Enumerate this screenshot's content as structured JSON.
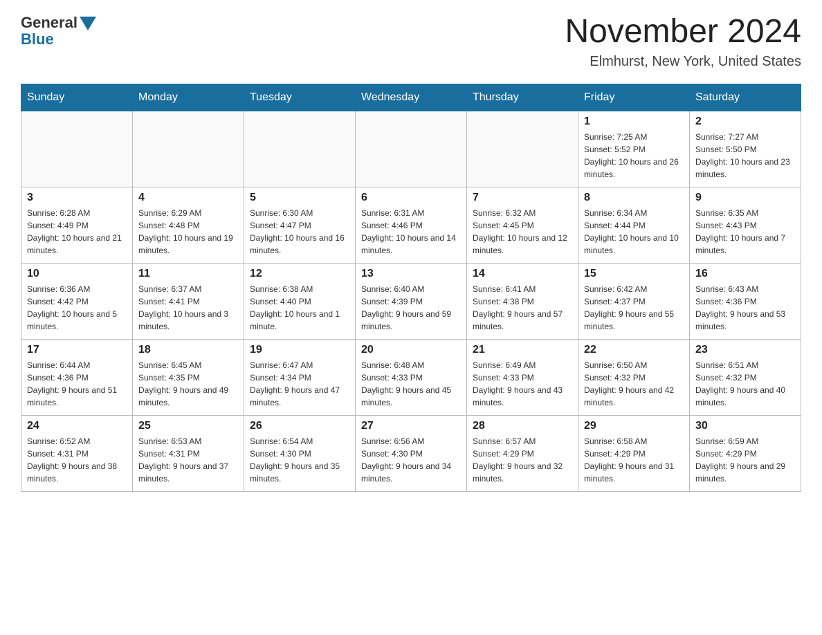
{
  "header": {
    "logo_general": "General",
    "logo_blue": "Blue",
    "month_title": "November 2024",
    "location": "Elmhurst, New York, United States"
  },
  "days_of_week": [
    "Sunday",
    "Monday",
    "Tuesday",
    "Wednesday",
    "Thursday",
    "Friday",
    "Saturday"
  ],
  "weeks": [
    [
      {
        "day": "",
        "sunrise": "",
        "sunset": "",
        "daylight": ""
      },
      {
        "day": "",
        "sunrise": "",
        "sunset": "",
        "daylight": ""
      },
      {
        "day": "",
        "sunrise": "",
        "sunset": "",
        "daylight": ""
      },
      {
        "day": "",
        "sunrise": "",
        "sunset": "",
        "daylight": ""
      },
      {
        "day": "",
        "sunrise": "",
        "sunset": "",
        "daylight": ""
      },
      {
        "day": "1",
        "sunrise": "Sunrise: 7:25 AM",
        "sunset": "Sunset: 5:52 PM",
        "daylight": "Daylight: 10 hours and 26 minutes."
      },
      {
        "day": "2",
        "sunrise": "Sunrise: 7:27 AM",
        "sunset": "Sunset: 5:50 PM",
        "daylight": "Daylight: 10 hours and 23 minutes."
      }
    ],
    [
      {
        "day": "3",
        "sunrise": "Sunrise: 6:28 AM",
        "sunset": "Sunset: 4:49 PM",
        "daylight": "Daylight: 10 hours and 21 minutes."
      },
      {
        "day": "4",
        "sunrise": "Sunrise: 6:29 AM",
        "sunset": "Sunset: 4:48 PM",
        "daylight": "Daylight: 10 hours and 19 minutes."
      },
      {
        "day": "5",
        "sunrise": "Sunrise: 6:30 AM",
        "sunset": "Sunset: 4:47 PM",
        "daylight": "Daylight: 10 hours and 16 minutes."
      },
      {
        "day": "6",
        "sunrise": "Sunrise: 6:31 AM",
        "sunset": "Sunset: 4:46 PM",
        "daylight": "Daylight: 10 hours and 14 minutes."
      },
      {
        "day": "7",
        "sunrise": "Sunrise: 6:32 AM",
        "sunset": "Sunset: 4:45 PM",
        "daylight": "Daylight: 10 hours and 12 minutes."
      },
      {
        "day": "8",
        "sunrise": "Sunrise: 6:34 AM",
        "sunset": "Sunset: 4:44 PM",
        "daylight": "Daylight: 10 hours and 10 minutes."
      },
      {
        "day": "9",
        "sunrise": "Sunrise: 6:35 AM",
        "sunset": "Sunset: 4:43 PM",
        "daylight": "Daylight: 10 hours and 7 minutes."
      }
    ],
    [
      {
        "day": "10",
        "sunrise": "Sunrise: 6:36 AM",
        "sunset": "Sunset: 4:42 PM",
        "daylight": "Daylight: 10 hours and 5 minutes."
      },
      {
        "day": "11",
        "sunrise": "Sunrise: 6:37 AM",
        "sunset": "Sunset: 4:41 PM",
        "daylight": "Daylight: 10 hours and 3 minutes."
      },
      {
        "day": "12",
        "sunrise": "Sunrise: 6:38 AM",
        "sunset": "Sunset: 4:40 PM",
        "daylight": "Daylight: 10 hours and 1 minute."
      },
      {
        "day": "13",
        "sunrise": "Sunrise: 6:40 AM",
        "sunset": "Sunset: 4:39 PM",
        "daylight": "Daylight: 9 hours and 59 minutes."
      },
      {
        "day": "14",
        "sunrise": "Sunrise: 6:41 AM",
        "sunset": "Sunset: 4:38 PM",
        "daylight": "Daylight: 9 hours and 57 minutes."
      },
      {
        "day": "15",
        "sunrise": "Sunrise: 6:42 AM",
        "sunset": "Sunset: 4:37 PM",
        "daylight": "Daylight: 9 hours and 55 minutes."
      },
      {
        "day": "16",
        "sunrise": "Sunrise: 6:43 AM",
        "sunset": "Sunset: 4:36 PM",
        "daylight": "Daylight: 9 hours and 53 minutes."
      }
    ],
    [
      {
        "day": "17",
        "sunrise": "Sunrise: 6:44 AM",
        "sunset": "Sunset: 4:36 PM",
        "daylight": "Daylight: 9 hours and 51 minutes."
      },
      {
        "day": "18",
        "sunrise": "Sunrise: 6:45 AM",
        "sunset": "Sunset: 4:35 PM",
        "daylight": "Daylight: 9 hours and 49 minutes."
      },
      {
        "day": "19",
        "sunrise": "Sunrise: 6:47 AM",
        "sunset": "Sunset: 4:34 PM",
        "daylight": "Daylight: 9 hours and 47 minutes."
      },
      {
        "day": "20",
        "sunrise": "Sunrise: 6:48 AM",
        "sunset": "Sunset: 4:33 PM",
        "daylight": "Daylight: 9 hours and 45 minutes."
      },
      {
        "day": "21",
        "sunrise": "Sunrise: 6:49 AM",
        "sunset": "Sunset: 4:33 PM",
        "daylight": "Daylight: 9 hours and 43 minutes."
      },
      {
        "day": "22",
        "sunrise": "Sunrise: 6:50 AM",
        "sunset": "Sunset: 4:32 PM",
        "daylight": "Daylight: 9 hours and 42 minutes."
      },
      {
        "day": "23",
        "sunrise": "Sunrise: 6:51 AM",
        "sunset": "Sunset: 4:32 PM",
        "daylight": "Daylight: 9 hours and 40 minutes."
      }
    ],
    [
      {
        "day": "24",
        "sunrise": "Sunrise: 6:52 AM",
        "sunset": "Sunset: 4:31 PM",
        "daylight": "Daylight: 9 hours and 38 minutes."
      },
      {
        "day": "25",
        "sunrise": "Sunrise: 6:53 AM",
        "sunset": "Sunset: 4:31 PM",
        "daylight": "Daylight: 9 hours and 37 minutes."
      },
      {
        "day": "26",
        "sunrise": "Sunrise: 6:54 AM",
        "sunset": "Sunset: 4:30 PM",
        "daylight": "Daylight: 9 hours and 35 minutes."
      },
      {
        "day": "27",
        "sunrise": "Sunrise: 6:56 AM",
        "sunset": "Sunset: 4:30 PM",
        "daylight": "Daylight: 9 hours and 34 minutes."
      },
      {
        "day": "28",
        "sunrise": "Sunrise: 6:57 AM",
        "sunset": "Sunset: 4:29 PM",
        "daylight": "Daylight: 9 hours and 32 minutes."
      },
      {
        "day": "29",
        "sunrise": "Sunrise: 6:58 AM",
        "sunset": "Sunset: 4:29 PM",
        "daylight": "Daylight: 9 hours and 31 minutes."
      },
      {
        "day": "30",
        "sunrise": "Sunrise: 6:59 AM",
        "sunset": "Sunset: 4:29 PM",
        "daylight": "Daylight: 9 hours and 29 minutes."
      }
    ]
  ]
}
